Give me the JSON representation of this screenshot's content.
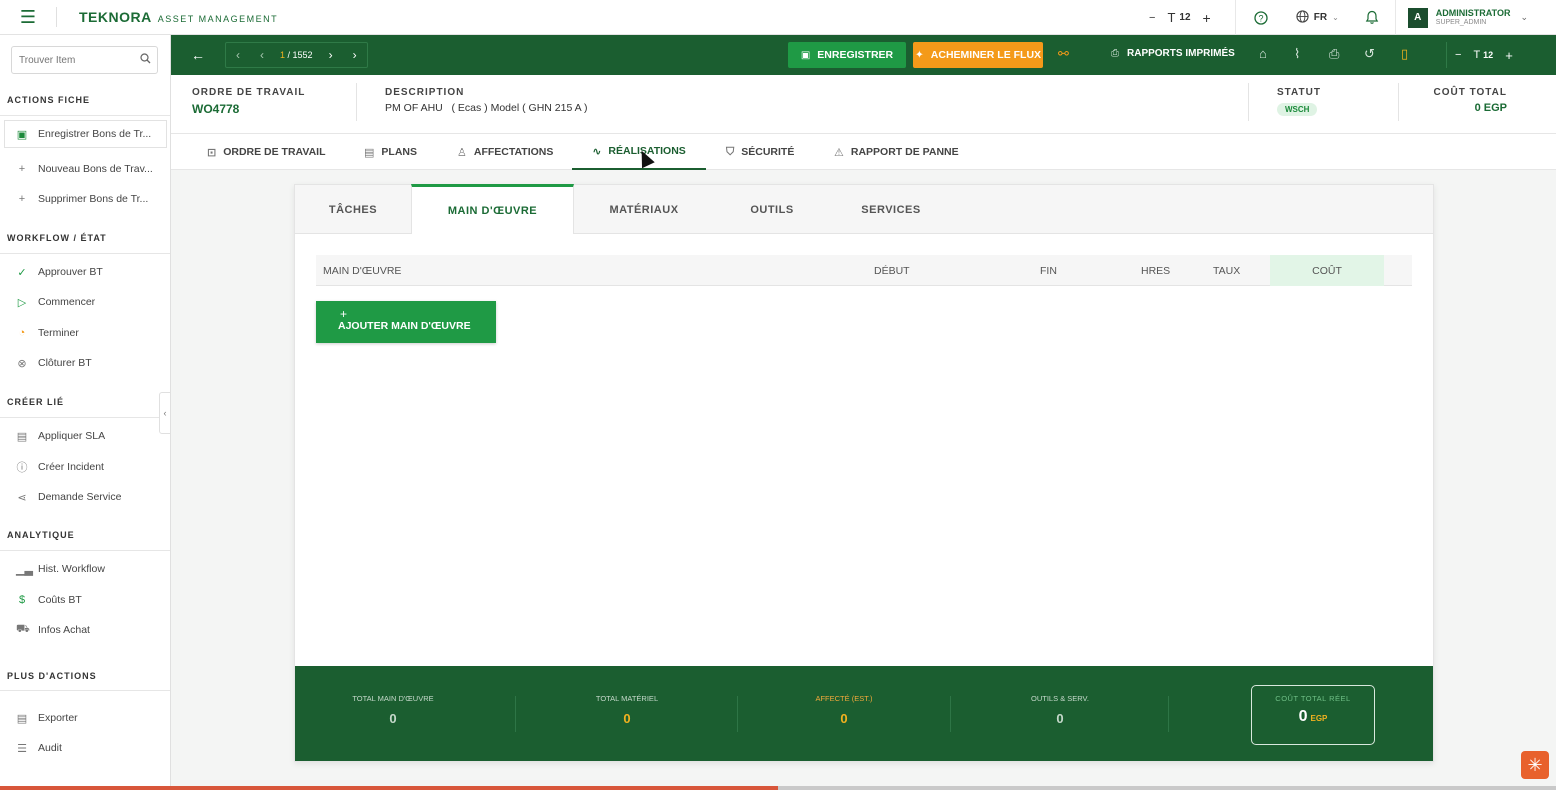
{
  "app": {
    "brand": "TEKNORA",
    "brand_sub": "ASSET MANAGEMENT",
    "font_size": "12",
    "language": "FR",
    "user_name": "ADMINISTRATOR",
    "user_role": "SUPER_ADMIN",
    "avatar_letter": "A"
  },
  "sidebar": {
    "search_placeholder": "Trouver Item",
    "sections": {
      "actions": "ACTIONS FICHE",
      "workflow": "WORKFLOW / ÉTAT",
      "create": "CRÉER LIÉ",
      "analytics": "ANALYTIQUE",
      "more": "PLUS D'ACTIONS"
    },
    "items": {
      "save": "Enregistrer Bons de Tr...",
      "new": "Nouveau Bons de Trav...",
      "delete": "Supprimer Bons de Tr...",
      "approve": "Approuver BT",
      "start": "Commencer",
      "finish": "Terminer",
      "close": "Clôturer BT",
      "sla": "Appliquer SLA",
      "incident": "Créer Incident",
      "service": "Demande Service",
      "history": "Hist. Workflow",
      "costs": "Coûts BT",
      "purchase": "Infos Achat",
      "export": "Exporter",
      "audit": "Audit"
    }
  },
  "toolbar": {
    "page_current": "1",
    "page_total": "/ 1552",
    "save_label": "ENREGISTRER",
    "flow_label": "ACHEMINER LE FLUX",
    "reports_label": "RAPPORTS IMPRIMÉS",
    "font_size": "12"
  },
  "header": {
    "work_order_label": "ORDRE DE TRAVAIL",
    "work_order_value": "WO4778",
    "description_label": "DESCRIPTION",
    "description_value": "PM OF AHU   ( Ecas ) Model ( GHN 215 A )",
    "status_label": "STATUT",
    "status_value": "WSCH",
    "total_cost_label": "COÛT TOTAL",
    "total_cost_value": "0 EGP"
  },
  "main_tabs": {
    "work_order": "ORDRE DE TRAVAIL",
    "plans": "PLANS",
    "assignments": "AFFECTATIONS",
    "achievements": "RÉALISATIONS",
    "safety": "SÉCURITÉ",
    "failure": "RAPPORT DE PANNE"
  },
  "sub_tabs": {
    "tasks": "TÂCHES",
    "labor": "MAIN D'ŒUVRE",
    "materials": "MATÉRIAUX",
    "tools": "OUTILS",
    "services": "SERVICES"
  },
  "table": {
    "columns": {
      "labor": "MAIN D'ŒUVRE",
      "start": "DÉBUT",
      "end": "FIN",
      "hours": "HRES",
      "rate": "TAUX",
      "cost": "COÛT"
    },
    "add_button_plus": "+",
    "add_button": "AJOUTER MAIN D'ŒUVRE"
  },
  "totals": {
    "labor_label": "TOTAL MAIN D'ŒUVRE",
    "labor_value": "0",
    "material_label": "TOTAL MATÉRIEL",
    "material_value": "0",
    "assigned_label": "AFFECTÉ (EST.)",
    "assigned_value": "0",
    "tools_label": "OUTILS & SERV.",
    "tools_value": "0",
    "real_label": "COÛT TOTAL RÉEL",
    "real_value": "0",
    "real_currency": "EGP"
  },
  "progress": {
    "fraction": 0.5
  },
  "colors": {
    "primary": "#1b5e30",
    "accent_green": "#1f9a45",
    "orange": "#f49a19",
    "gold": "#f2b21f"
  }
}
